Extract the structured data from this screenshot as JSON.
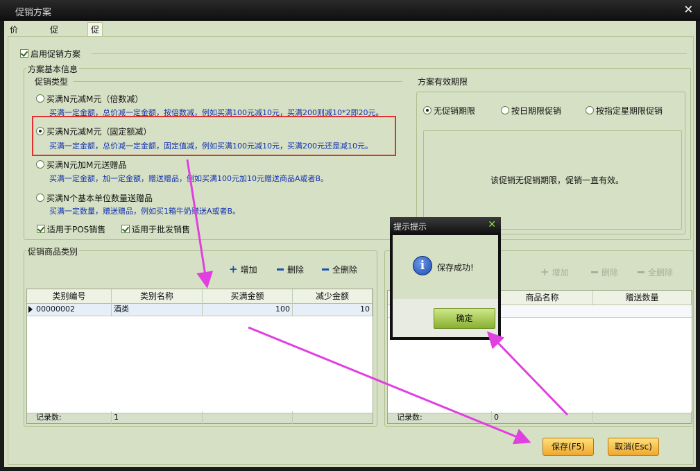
{
  "window": {
    "title": "促销方案",
    "close": "✕"
  },
  "tabs": [
    "价格设置",
    "促销查询",
    "促销方案设置"
  ],
  "enable_label": "启用促销方案",
  "basic_info": {
    "title": "方案基本信息",
    "promo_type_title": "促销类型",
    "options": [
      {
        "label": "买满N元减M元（倍数减）",
        "desc": "买满一定金额，总价减一定金额，按倍数减，例如买满100元减10元，买满200则减10*2即20元。"
      },
      {
        "label": "买满N元减M元（固定额减）",
        "desc": "买满一定金额，总价减一定金额，固定值减，例如买满100元减10元，买满200元还是减10元。"
      },
      {
        "label": "买满N元加M元送赠品",
        "desc": "买满一定金额，加一定金额，赠送赠品，例如买满100元加10元赠送商品A或者B。"
      },
      {
        "label": "买满N个基本单位数量送赠品",
        "desc": "买满一定数量，赠送赠品，例如买1箱牛奶赠送A或者B。"
      }
    ],
    "pos_label": "适用于POS销售",
    "wholesale_label": "适用于批发销售"
  },
  "validity": {
    "title": "方案有效期限",
    "options": [
      "无促销期限",
      "按日期限促销",
      "按指定星期限促销"
    ],
    "message": "该促销无促销期限，促销一直有效。"
  },
  "category": {
    "title": "促销商品类别",
    "add": "增加",
    "delete": "删除",
    "delete_all": "全删除",
    "columns": [
      "类别编号",
      "类别名称",
      "买满金额",
      "减少金额"
    ],
    "rows": [
      [
        "00000002",
        "酒类",
        "100",
        "10"
      ]
    ],
    "footer_label": "记录数:",
    "footer_count": "1"
  },
  "gift": {
    "add": "增加",
    "delete": "删除",
    "delete_all": "全删除",
    "columns": [
      "商品名称",
      "赠送数量"
    ],
    "footer_label": "记录数:",
    "footer_count": "0"
  },
  "buttons": {
    "save": "保存(F5)",
    "cancel": "取消(Esc)"
  },
  "dialog": {
    "title": "提示提示",
    "close": "✕",
    "icon": "i",
    "message": "保存成功!",
    "ok": "确定"
  },
  "colors": {
    "background": "#d6e0c4",
    "annotation": "#e040e0",
    "highlight": "#e23030",
    "desc_text": "#1030b0"
  }
}
